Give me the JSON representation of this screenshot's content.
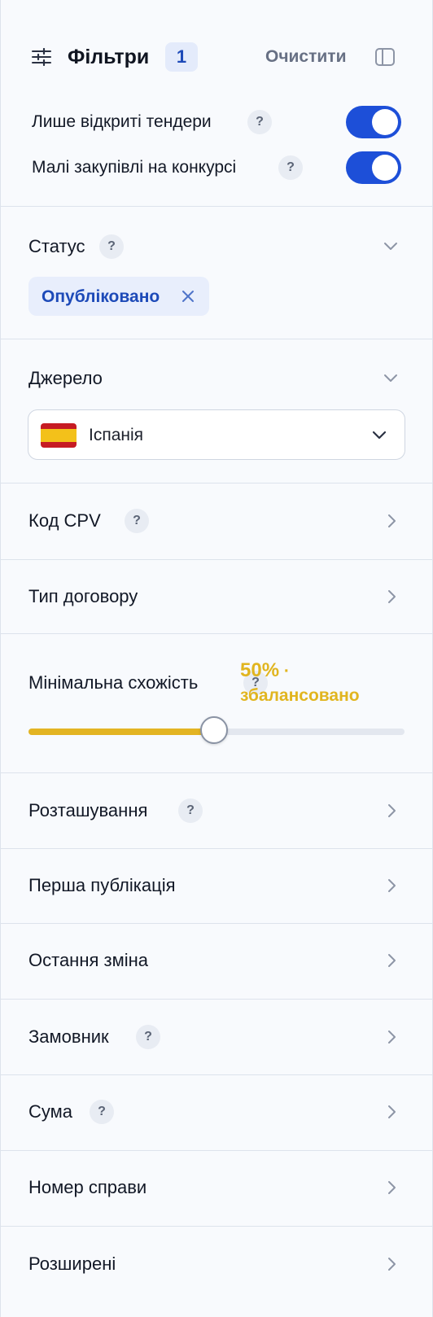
{
  "header": {
    "title": "Фільтри",
    "active_count": "1",
    "clear_label": "Очистити",
    "toggles": [
      {
        "label": "Лише відкриті тендери",
        "help": "?",
        "on": true
      },
      {
        "label": "Малі закупівлі на конкурсі",
        "help": "?",
        "on": true
      }
    ]
  },
  "status": {
    "label": "Статус",
    "help": "?",
    "chip": "Опубліковано"
  },
  "source": {
    "label": "Джерело",
    "selected": "Іспанія",
    "flag_icon": "spain-flag-icon"
  },
  "cpv": {
    "label": "Код CPV",
    "help": "?"
  },
  "contract_type": {
    "label": "Тип договору"
  },
  "similarity": {
    "label": "Мінімальна схожість",
    "help": "?",
    "value_percent": "50%",
    "value_separator": "·",
    "value_text": "збалансовано",
    "level": 0.5,
    "accent_color": "#e3b423"
  },
  "location": {
    "label": "Розташування",
    "help": "?"
  },
  "first_published": {
    "label": "Перша публікація"
  },
  "last_changed": {
    "label": "Остання зміна"
  },
  "customer": {
    "label": "Замовник",
    "help": "?"
  },
  "amount": {
    "label": "Сума",
    "help": "?"
  },
  "case_number": {
    "label": "Номер справи"
  },
  "advanced": {
    "label": "Розширені"
  },
  "colors": {
    "primary": "#1d4fd8",
    "badge_bg": "#e4ebfb",
    "chip_text": "#1d4ab8",
    "panel_bg": "#f8fafd"
  }
}
